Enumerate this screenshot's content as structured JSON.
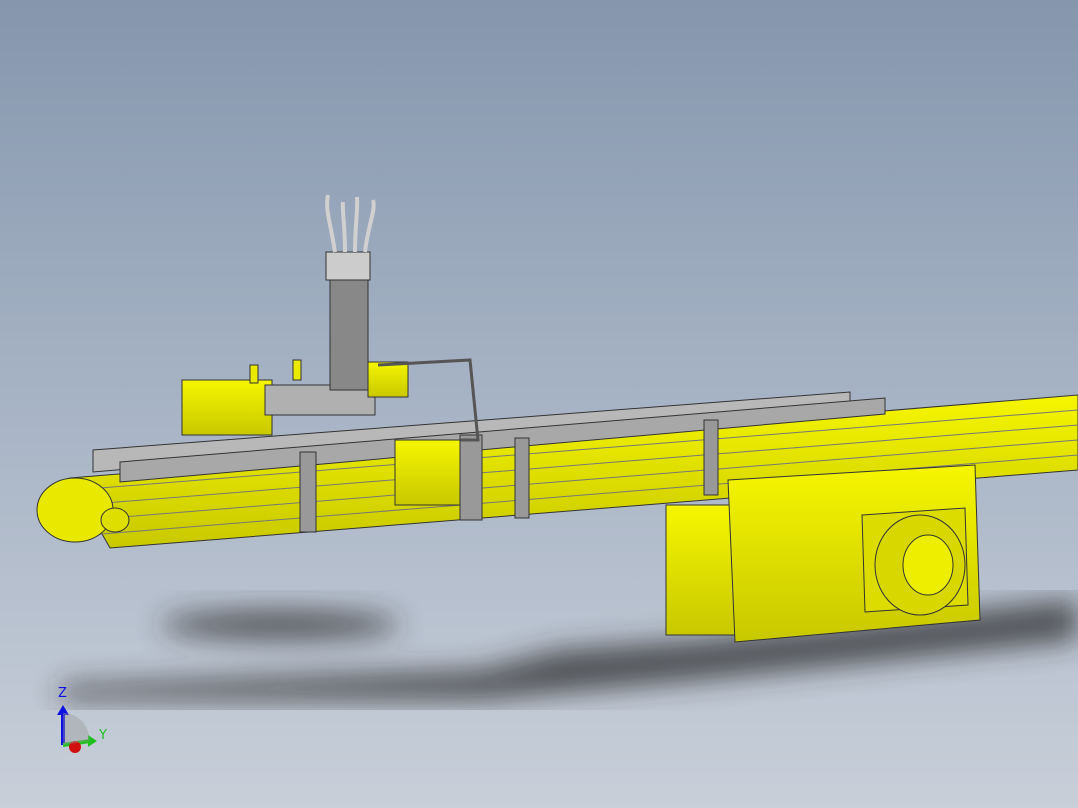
{
  "viewport": {
    "background_top": "#8596ad",
    "background_bottom": "#c8cfd9",
    "part_color": "#ecec00"
  },
  "triad": {
    "z_label": "Z",
    "y_label": "Y",
    "z_color": "#1010e0",
    "y_color": "#20c020",
    "x_color": "#e01010"
  }
}
